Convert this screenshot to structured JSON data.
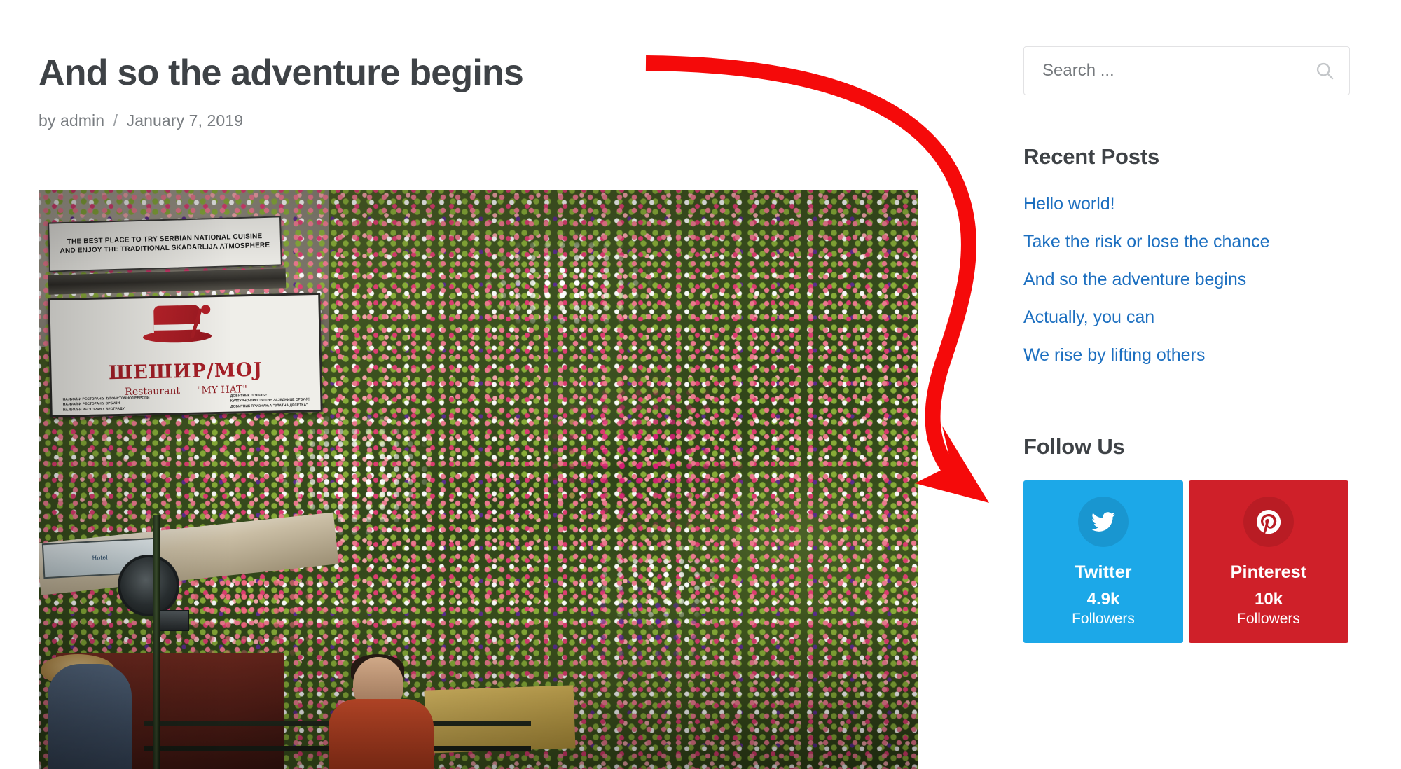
{
  "post": {
    "title": "And so the adventure begins",
    "byline_prefix": "by",
    "author": "admin",
    "separator": "/",
    "date": "January 7, 2019",
    "featured_image": {
      "alt": "Flower-covered wall of Šešir Moj restaurant in Skadarlija, Belgrade",
      "sign_top_line1": "THE BEST PLACE TO TRY SERBIAN NATIONAL CUISINE",
      "sign_top_line2": "AND ENJOY THE TRADITIONAL SKADARLIJA ATMOSPHERE",
      "sign_name": "ШЕШИР/МОЈ",
      "sign_sub_left": "Restaurant",
      "sign_sub_right": "\"MY HAT\"",
      "sign_fine_left": "НАЈБОЉИ РЕСТОРАН У ЈУГОИСТОЧНОЈ ЕВРОПИ\nНАЈБОЉИ РЕСТОРАН У СРБИЈИ\nНАЈБОЉИ РЕСТОРАН У БЕОГРАДУ",
      "sign_fine_right": "ДОБИТНИК ПОВЕЉЕ\nКУЛТУРНО-ПРОСВЕТНЕ ЗАЈЕДНИЦЕ СРБИЈЕ\nДОБИТНИК ПРИЗНАЊА \"ЗЛАТНА ДЕСЕТКА\"",
      "shop_sign_text": "Hotel"
    }
  },
  "sidebar": {
    "search": {
      "placeholder": "Search ...",
      "value": "",
      "icon": "search-icon"
    },
    "recent_posts": {
      "title": "Recent Posts",
      "items": [
        {
          "label": "Hello world!"
        },
        {
          "label": "Take the risk or lose the chance"
        },
        {
          "label": "And so the adventure begins"
        },
        {
          "label": "Actually, you can"
        },
        {
          "label": "We rise by lifting others"
        }
      ]
    },
    "follow_us": {
      "title": "Follow Us",
      "cards": [
        {
          "network": "Twitter",
          "icon": "twitter-bird-icon",
          "count": "4.9k",
          "label": "Followers",
          "color": "#1ca8e8"
        },
        {
          "network": "Pinterest",
          "icon": "pinterest-p-icon",
          "count": "10k",
          "label": "Followers",
          "color": "#cf2029"
        }
      ]
    }
  },
  "annotation": {
    "type": "curved-arrow",
    "color": "#f50a0a",
    "points_from": "post-title",
    "points_to": "follow-us-widget"
  },
  "colors": {
    "link": "#1c6fc0",
    "heading": "#3e4246",
    "meta": "#787c80",
    "divider": "#e6e6e8",
    "annotation": "#f50a0a"
  }
}
